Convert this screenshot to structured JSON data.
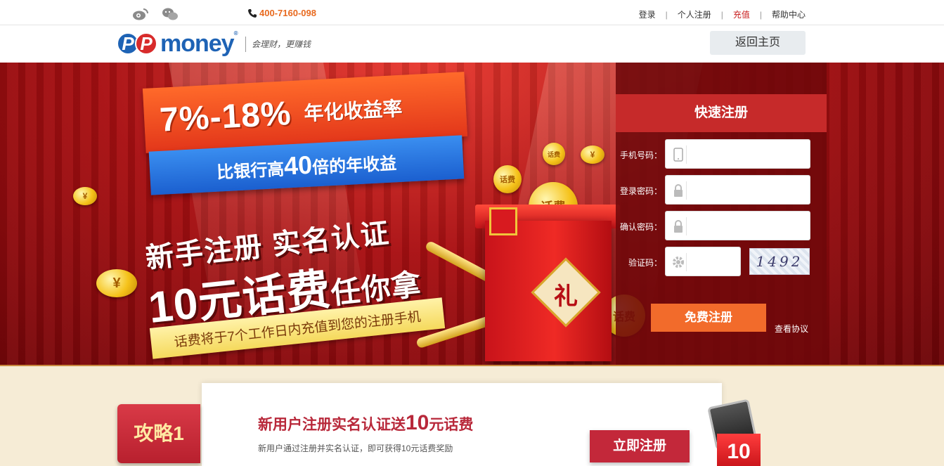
{
  "topbar": {
    "phone": "400-7160-098",
    "links": [
      {
        "label": "登录"
      },
      {
        "label": "个人注册"
      },
      {
        "label": "充值"
      },
      {
        "label": "帮助中心"
      }
    ]
  },
  "header": {
    "logo_text": "PPmoney",
    "slogan": "会理财，更赚钱",
    "home_button": "返回主页"
  },
  "banner": {
    "rate_percent": "7%-18%",
    "rate_label": "年化收益率",
    "compare_prefix": "比银行高",
    "compare_number": "40",
    "compare_suffix": "倍的年收益",
    "headline1": "新手注册 实名认证",
    "headline2_amount": "10元话费",
    "headline2_suffix": "任你拿",
    "note": "话费将于7个工作日内充值到您的注册手机",
    "coin_text": "话费",
    "gift_char": "礼"
  },
  "register": {
    "title": "快速注册",
    "fields": [
      {
        "label": "手机号码：",
        "icon": "mobile-icon",
        "value": ""
      },
      {
        "label": "登录密码：",
        "icon": "lock-icon",
        "value": ""
      },
      {
        "label": "确认密码：",
        "icon": "lock-icon",
        "value": ""
      },
      {
        "label": "验证码：",
        "icon": "gear-icon",
        "value": ""
      }
    ],
    "captcha_text": "1492",
    "submit": "免费注册",
    "agreement": "查看协议"
  },
  "promo": {
    "tag": "攻略1",
    "title_prefix": "新用户注册实名认证送",
    "title_number": "10",
    "title_suffix": "元话费",
    "subtitle": "新用户通过注册并实名认证，即可获得10元话费奖励",
    "cta": "立即注册",
    "badge_number": "10"
  },
  "colors": {
    "brand_blue": "#1e63b5",
    "brand_red": "#c62a2a",
    "cta_orange": "#f26b2b",
    "phone_orange": "#e86a1f"
  }
}
